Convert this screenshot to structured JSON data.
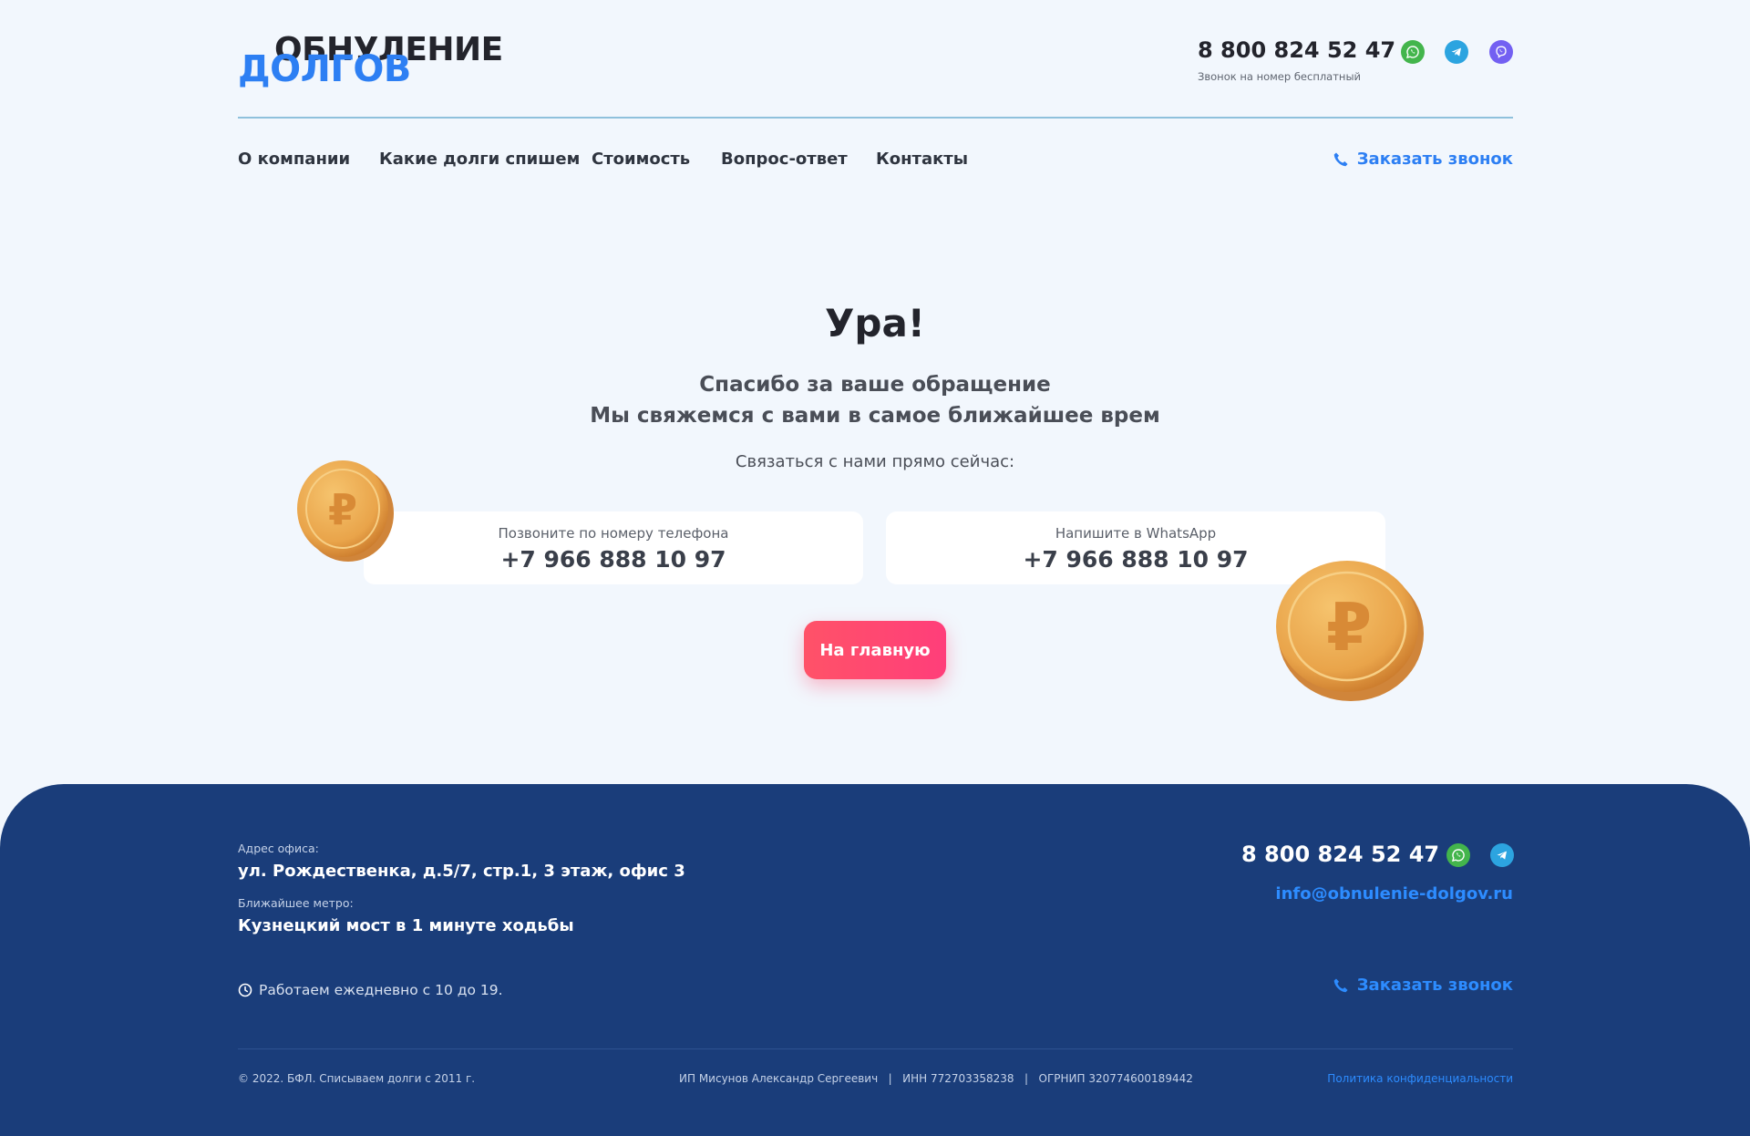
{
  "header": {
    "logo_top": "ОБНУЛЕНИЕ",
    "logo_bottom": "ДОЛГОВ",
    "phone": "8 800 824 52 47",
    "phone_note": "Звонок на номер бесплатный",
    "messengers": [
      "whatsapp-icon",
      "telegram-icon",
      "viber-icon"
    ]
  },
  "nav": {
    "items": [
      "О компании",
      "Какие долги спишем",
      "Стоимость",
      "Вопрос-ответ",
      "Контакты"
    ],
    "callback": "Заказать звонок"
  },
  "main": {
    "headline": "Ура!",
    "subtitle_line1": "Спасибо за ваше обращение",
    "subtitle_line2": "Мы свяжемся с вами в самое ближайшее врем",
    "contact_prompt": "Связаться с нами прямо сейчас:",
    "cards": [
      {
        "label": "Позвоните по номеру телефона",
        "value": "+7 966 888 10 97"
      },
      {
        "label": "Напишите в WhatsApp",
        "value": "+7 966 888 10 97"
      }
    ],
    "home_button": "На главную"
  },
  "footer": {
    "address_label": "Адрес офиса:",
    "address": "ул. Рождественка, д.5/7, стр.1, 3 этаж, офис 3",
    "metro_label": "Ближайшее метро:",
    "metro": "Кузнецкий мост в 1 минуте ходьбы",
    "hours": "Работаем ежедневно с 10 до 19.",
    "phone": "8 800 824 52 47",
    "email": "info@obnulenie-dolgov.ru",
    "callback": "Заказать звонок",
    "copyright": "© 2022. БФЛ. Списываем долги с 2011 г.",
    "legal": "ИП Мисунов Александр Сергеевич   |   ИНН 772703358238   |   ОГРНИП 320774600189442",
    "policy": "Политика конфиденциальности"
  },
  "colors": {
    "accent": "#2d7ff3",
    "button": "#ff4a70",
    "footer_bg": "#1a3d7a",
    "page_bg": "#f2f7fd",
    "coin": "#e9a44a"
  }
}
